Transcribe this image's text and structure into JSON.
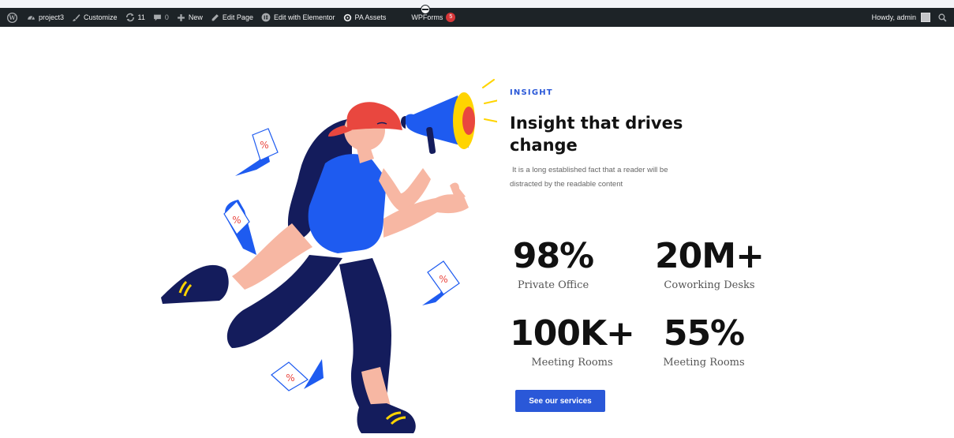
{
  "adminbar": {
    "site_name": "project3",
    "customize": "Customize",
    "updates_count": "11",
    "comments_count": "0",
    "new": "New",
    "edit_page": "Edit Page",
    "edit_elementor": "Edit with Elementor",
    "pa_assets": "PA Assets",
    "wpforms": "WPForms",
    "wpforms_badge": "5",
    "howdy": "Howdy, admin",
    "icons": [
      "wordpress-logo-icon",
      "dashboard-icon",
      "brush-icon",
      "refresh-icon",
      "comment-icon",
      "plus-icon",
      "pencil-icon",
      "elementor-icon",
      "pa-assets-icon",
      "search-icon"
    ]
  },
  "section": {
    "eyebrow": "INSIGHT",
    "heading": "Insight that drives change",
    "description": "It is a long established fact that a reader will be distracted by the readable content"
  },
  "stats": [
    {
      "value": "98%",
      "label": "Private Office"
    },
    {
      "value": "20M+",
      "label": "Coworking Desks"
    },
    {
      "value": "100K+",
      "label": "Meeting Rooms"
    },
    {
      "value": "55%",
      "label": "Meeting Rooms"
    }
  ],
  "cta": {
    "label": "See our services"
  },
  "colors": {
    "accent": "#2a58d8",
    "adminbar": "#1d2327",
    "heading": "#121212",
    "figure_navy": "#141c5c",
    "figure_blue": "#1e5bf0",
    "figure_skin": "#f7b7a3",
    "cap_red": "#e9473f",
    "megaphone_yellow": "#ffd400"
  }
}
